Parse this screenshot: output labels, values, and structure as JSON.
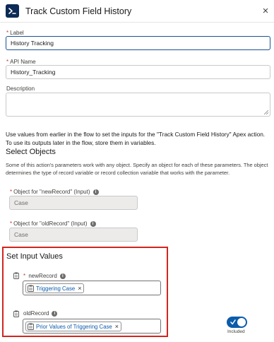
{
  "header": {
    "title": "Track Custom Field History",
    "icon": "apex-action-icon",
    "close": "×"
  },
  "colors": {
    "accent": "#0b5cab",
    "header_icon_bg": "#0b2a55",
    "highlight_border": "#d1261e",
    "required": "#c23934"
  },
  "fields": {
    "label": {
      "label": "Label",
      "required_mark": "*",
      "value": "History Tracking"
    },
    "api_name": {
      "label": "API Name",
      "required_mark": "*",
      "value": "History_Tracking"
    },
    "description": {
      "label": "Description",
      "value": ""
    }
  },
  "intro_text": "Use values from earlier in the flow to set the inputs for the \"Track Custom Field History\" Apex action. To use its outputs later in the flow, store them in variables.",
  "select_objects": {
    "title": "Select Objects",
    "help": "Some of this action's parameters work with any object. Specify an object for each of these parameters. The object determines the type of record variable or record collection variable that works with the parameter.",
    "new_record": {
      "label": "Object for \"newRecord\" (Input)",
      "required_mark": "*",
      "value": "Case"
    },
    "old_record": {
      "label": "Object for \"oldRecord\" (Input)",
      "required_mark": "*",
      "value": "Case"
    }
  },
  "input_values": {
    "title": "Set Input Values",
    "new_record": {
      "label": "newRecord",
      "required_mark": "*",
      "pill": "Triggering Case",
      "remove": "×"
    },
    "old_record": {
      "label": "oldRecord",
      "pill": "Prior Values of Triggering Case",
      "remove": "×"
    },
    "toggle_label": "Included",
    "toggle_on": true
  },
  "info_glyph": "i"
}
